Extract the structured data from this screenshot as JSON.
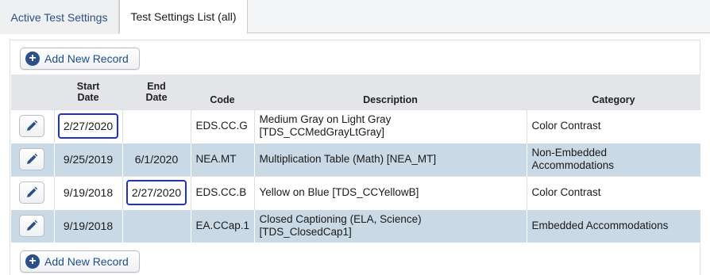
{
  "tabs": [
    {
      "label": "Active Test Settings"
    },
    {
      "label": "Test Settings List (all)"
    }
  ],
  "buttons": {
    "add_new_record": "Add New Record",
    "add_icon_glyph": "+"
  },
  "table": {
    "headers": {
      "start_date_line1": "Start",
      "start_date_line2": "Date",
      "end_date_line1": "End",
      "end_date_line2": "Date",
      "code": "Code",
      "description": "Description",
      "category": "Category"
    },
    "rows": [
      {
        "start": "2/27/2020",
        "end": "",
        "code": "EDS.CC.G",
        "description_line1": "Medium Gray on Light Gray",
        "description_line2": "[TDS_CCMedGrayLtGray]",
        "category_line1": "Color Contrast",
        "category_line2": ""
      },
      {
        "start": "9/25/2019",
        "end": "6/1/2020",
        "code": "NEA.MT",
        "description_line1": "Multiplication Table (Math) [NEA_MT]",
        "description_line2": "",
        "category_line1": "Non-Embedded",
        "category_line2": "Accommodations"
      },
      {
        "start": "9/19/2018",
        "end": "2/27/2020",
        "code": "EDS.CC.B",
        "description_line1": "Yellow on Blue [TDS_CCYellowB]",
        "description_line2": "",
        "category_line1": "Color Contrast",
        "category_line2": ""
      },
      {
        "start": "9/19/2018",
        "end": "",
        "code": "EA.CCap.1",
        "description_line1": "Closed Captioning (ELA, Science)",
        "description_line2": "[TDS_ClosedCap1]",
        "category_line1": "Embedded Accommodations",
        "category_line2": ""
      }
    ]
  },
  "colors": {
    "accent": "#2c4f86",
    "row_blue": "#c9d9e6",
    "header_gray": "#e3e5e8",
    "highlight_border": "#1d2fd6"
  },
  "icons": {
    "edit": "pencil-icon",
    "add": "plus-circle-icon"
  }
}
